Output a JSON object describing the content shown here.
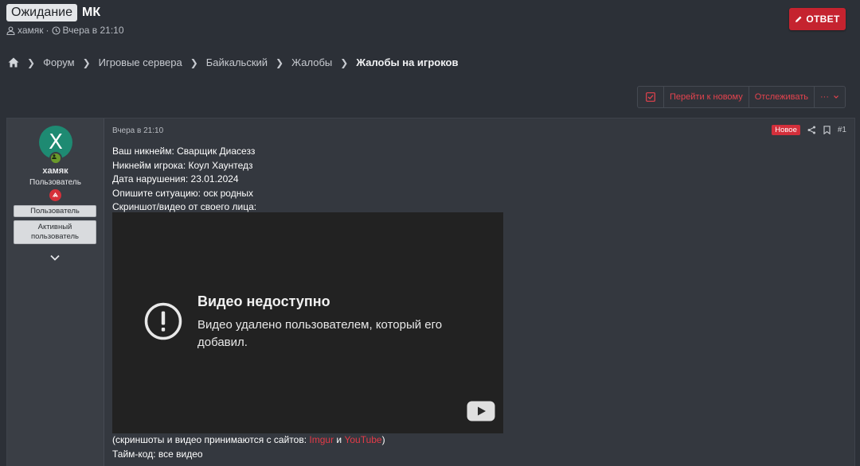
{
  "thread": {
    "prefix": "Ожидание",
    "title": "МК",
    "author": "хамяк",
    "meta_sep": "·",
    "time": "Вчера в 21:10",
    "reply_label": "ОТВЕТ"
  },
  "breadcrumb": {
    "items": [
      "Форум",
      "Игровые сервера",
      "Байкальский",
      "Жалобы",
      "Жалобы на игроков"
    ]
  },
  "actions": {
    "goto_new": "Перейти к новому",
    "watch": "Отслеживать",
    "more": "···"
  },
  "user": {
    "avatar_letter": "X",
    "name": "хамяк",
    "title": "Пользователь",
    "banners": [
      "Пользователь",
      "Активный пользователь"
    ]
  },
  "post": {
    "date": "Вчера в 21:10",
    "new_badge": "Новое",
    "number": "#1",
    "lines": [
      "Ваш никнейм: Сварщик Диасезз",
      "Никнейм игрока: Коул Хаунтедз",
      "Дата нарушения: 23.01.2024",
      "Опишите ситуацию: оск родных",
      "Скриншот/видео от своего лица:"
    ],
    "video": {
      "title": "Видео недоступно",
      "text": "Видео удалено пользователем, который его добавил."
    },
    "sites_prefix": "(скриншоты и видео принимаются с сайтов: ",
    "link_imgur": "Imgur",
    "sites_and": " и ",
    "link_youtube": "YouTube",
    "sites_suffix": ")",
    "timecode": "Тайм-код: все видео"
  },
  "colors": {
    "accent": "#c5232f",
    "link": "#e33a47",
    "avatar": "#1e8a72"
  }
}
